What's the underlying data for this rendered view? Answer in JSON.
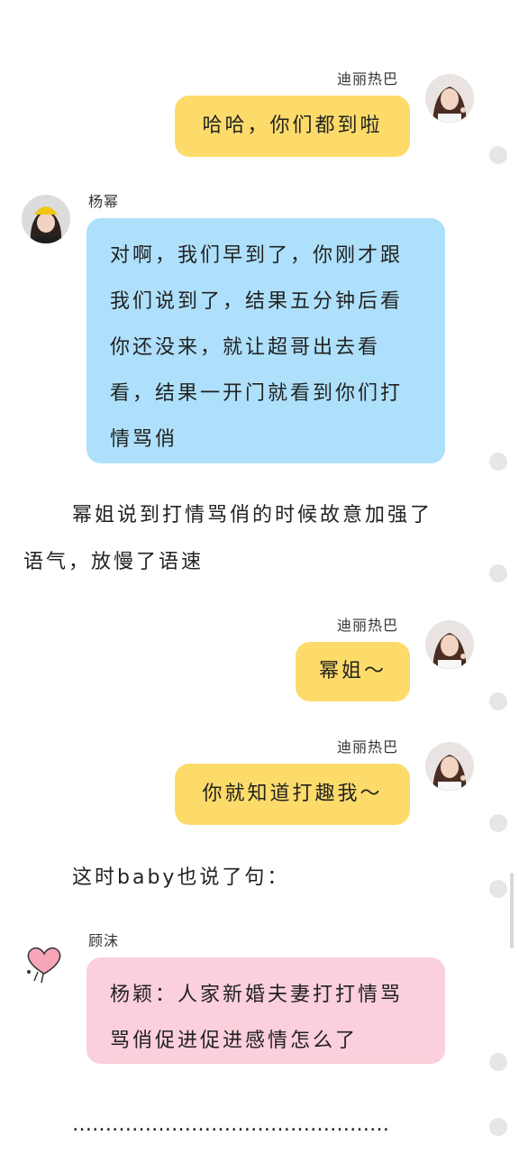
{
  "messages": [
    {
      "name": "迪丽热巴",
      "text": "哈哈，你们都到啦"
    },
    {
      "name": "杨幂",
      "text": "对啊，我们早到了，你刚才跟我们说到了，结果五分钟后看你还没来，就让超哥出去看看，结果一开门就看到你们打情骂俏"
    },
    {
      "name": "迪丽热巴",
      "text": "幂姐～"
    },
    {
      "name": "迪丽热巴",
      "text": "你就知道打趣我～"
    },
    {
      "name": "顾沫",
      "text": "杨颖：人家新婚夫妻打打情骂骂俏促进促进感情怎么了"
    }
  ],
  "blue_lines": [
    "对啊，我们早到了，你刚才跟",
    "我们说到了，结果五分钟后看",
    "你还没来，就让超哥出去看",
    "看，结果一开门就看到你们打",
    "情骂俏"
  ],
  "pink_lines": [
    "杨颖：人家新婚夫妻打打情骂",
    "骂俏促进促进感情怎么了"
  ],
  "narration": {
    "n1_line1": "幂姐说到打情骂俏的时候故意加强了",
    "n1_line2": "语气，放慢了语速",
    "n2": "这时baby也说了句：",
    "ellipsis": "…………………………………………"
  },
  "colors": {
    "yellow": "#fddb6a",
    "blue": "#aee0fb",
    "pink": "#fbcfdb"
  }
}
